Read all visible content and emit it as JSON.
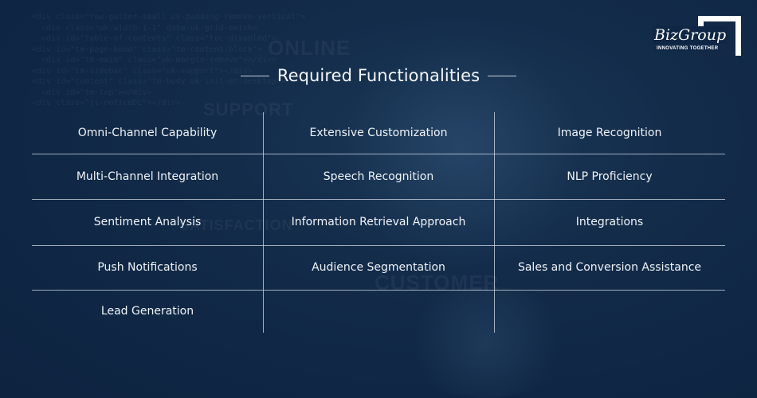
{
  "logo": {
    "name": "BizGroup",
    "tagline": "INNOVATING TOGETHER"
  },
  "title": "Required Functionalities",
  "background": {
    "words": [
      "ONLINE",
      "SUPPORT",
      "SATISFACTION",
      "CUSTOMER"
    ],
    "code_lines": [
      "<div class=\"row-gutter-small uk-padding-remove-vertical\">",
      "  <div class=\"uk-width-1-1\" data-uk-grid-match>",
      "  <div id=\"table-of-contents\" class=\"toc-disabled\">",
      "<div id=\"tm-page-head\" class=\"tm-content-block\">",
      "  <div id=\"tm-main\" class=\"uk-margin-remove\"></div>",
      "<div id=\"tm-sidebar\" class=\"uk-support\"></div>",
      "<div id=\"content\" class=\"tm-body uk-init-mc-desktop\">",
      "  <div id=\"tm-top\"></div>",
      "<div class=\"js-noticeDL\"></div>"
    ],
    "colors": {
      "base": "#0f2744",
      "line": "#d2dae4",
      "text": "#f0f3f7"
    }
  },
  "grid": {
    "columns": 3,
    "cells": [
      [
        "Omni-Channel Capability",
        "Extensive Customization",
        "Image Recognition"
      ],
      [
        "Multi-Channel Integration",
        "Speech Recognition",
        "NLP Proficiency"
      ],
      [
        "Sentiment Analysis",
        "Information Retrieval Approach",
        "Integrations"
      ],
      [
        "Push Notifications",
        "Audience Segmentation",
        "Sales and Conversion Assistance"
      ],
      [
        "Lead Generation",
        "",
        ""
      ]
    ]
  }
}
